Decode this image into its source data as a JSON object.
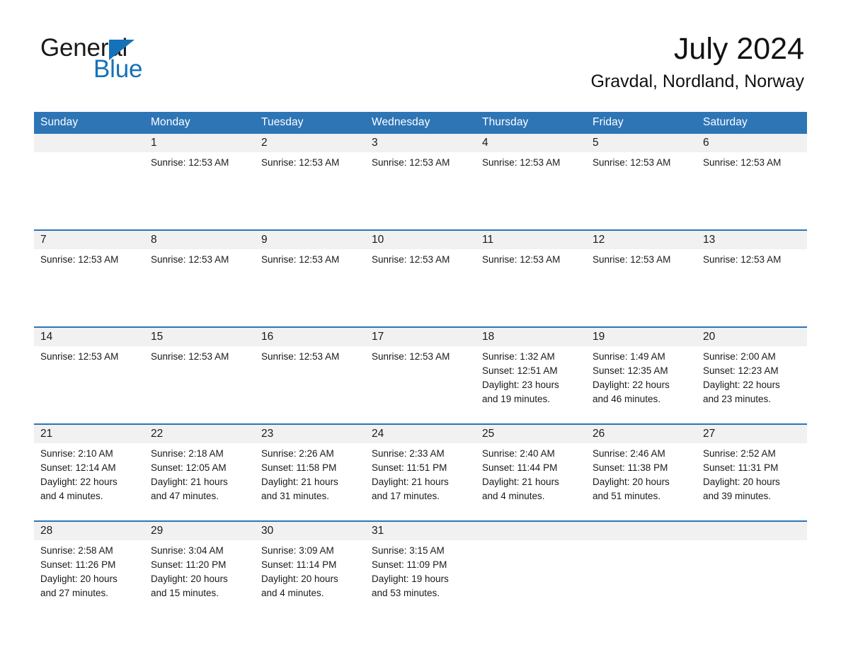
{
  "brand": {
    "name_part1": "General",
    "name_part2": "Blue",
    "accent_color": "#1572b8"
  },
  "header": {
    "month_title": "July 2024",
    "location": "Gravdal, Nordland, Norway"
  },
  "theme": {
    "header_bar_color": "#2e75b6",
    "daynum_band_color": "#f1f1f1",
    "row_divider_color": "#2e75b6"
  },
  "calendar": {
    "weekday_headers": [
      "Sunday",
      "Monday",
      "Tuesday",
      "Wednesday",
      "Thursday",
      "Friday",
      "Saturday"
    ],
    "weeks": [
      [
        {
          "day": "",
          "text": ""
        },
        {
          "day": "1",
          "text": "Sunrise: 12:53 AM"
        },
        {
          "day": "2",
          "text": "Sunrise: 12:53 AM"
        },
        {
          "day": "3",
          "text": "Sunrise: 12:53 AM"
        },
        {
          "day": "4",
          "text": "Sunrise: 12:53 AM"
        },
        {
          "day": "5",
          "text": "Sunrise: 12:53 AM"
        },
        {
          "day": "6",
          "text": "Sunrise: 12:53 AM"
        }
      ],
      [
        {
          "day": "7",
          "text": "Sunrise: 12:53 AM"
        },
        {
          "day": "8",
          "text": "Sunrise: 12:53 AM"
        },
        {
          "day": "9",
          "text": "Sunrise: 12:53 AM"
        },
        {
          "day": "10",
          "text": "Sunrise: 12:53 AM"
        },
        {
          "day": "11",
          "text": "Sunrise: 12:53 AM"
        },
        {
          "day": "12",
          "text": "Sunrise: 12:53 AM"
        },
        {
          "day": "13",
          "text": "Sunrise: 12:53 AM"
        }
      ],
      [
        {
          "day": "14",
          "text": "Sunrise: 12:53 AM"
        },
        {
          "day": "15",
          "text": "Sunrise: 12:53 AM"
        },
        {
          "day": "16",
          "text": "Sunrise: 12:53 AM"
        },
        {
          "day": "17",
          "text": "Sunrise: 12:53 AM"
        },
        {
          "day": "18",
          "text": "Sunrise: 1:32 AM\nSunset: 12:51 AM\nDaylight: 23 hours\nand 19 minutes."
        },
        {
          "day": "19",
          "text": "Sunrise: 1:49 AM\nSunset: 12:35 AM\nDaylight: 22 hours\nand 46 minutes."
        },
        {
          "day": "20",
          "text": "Sunrise: 2:00 AM\nSunset: 12:23 AM\nDaylight: 22 hours\nand 23 minutes."
        }
      ],
      [
        {
          "day": "21",
          "text": "Sunrise: 2:10 AM\nSunset: 12:14 AM\nDaylight: 22 hours\nand 4 minutes."
        },
        {
          "day": "22",
          "text": "Sunrise: 2:18 AM\nSunset: 12:05 AM\nDaylight: 21 hours\nand 47 minutes."
        },
        {
          "day": "23",
          "text": "Sunrise: 2:26 AM\nSunset: 11:58 PM\nDaylight: 21 hours\nand 31 minutes."
        },
        {
          "day": "24",
          "text": "Sunrise: 2:33 AM\nSunset: 11:51 PM\nDaylight: 21 hours\nand 17 minutes."
        },
        {
          "day": "25",
          "text": "Sunrise: 2:40 AM\nSunset: 11:44 PM\nDaylight: 21 hours\nand 4 minutes."
        },
        {
          "day": "26",
          "text": "Sunrise: 2:46 AM\nSunset: 11:38 PM\nDaylight: 20 hours\nand 51 minutes."
        },
        {
          "day": "27",
          "text": "Sunrise: 2:52 AM\nSunset: 11:31 PM\nDaylight: 20 hours\nand 39 minutes."
        }
      ],
      [
        {
          "day": "28",
          "text": "Sunrise: 2:58 AM\nSunset: 11:26 PM\nDaylight: 20 hours\nand 27 minutes."
        },
        {
          "day": "29",
          "text": "Sunrise: 3:04 AM\nSunset: 11:20 PM\nDaylight: 20 hours\nand 15 minutes."
        },
        {
          "day": "30",
          "text": "Sunrise: 3:09 AM\nSunset: 11:14 PM\nDaylight: 20 hours\nand 4 minutes."
        },
        {
          "day": "31",
          "text": "Sunrise: 3:15 AM\nSunset: 11:09 PM\nDaylight: 19 hours\nand 53 minutes."
        },
        {
          "day": "",
          "text": ""
        },
        {
          "day": "",
          "text": ""
        },
        {
          "day": "",
          "text": ""
        }
      ]
    ]
  }
}
